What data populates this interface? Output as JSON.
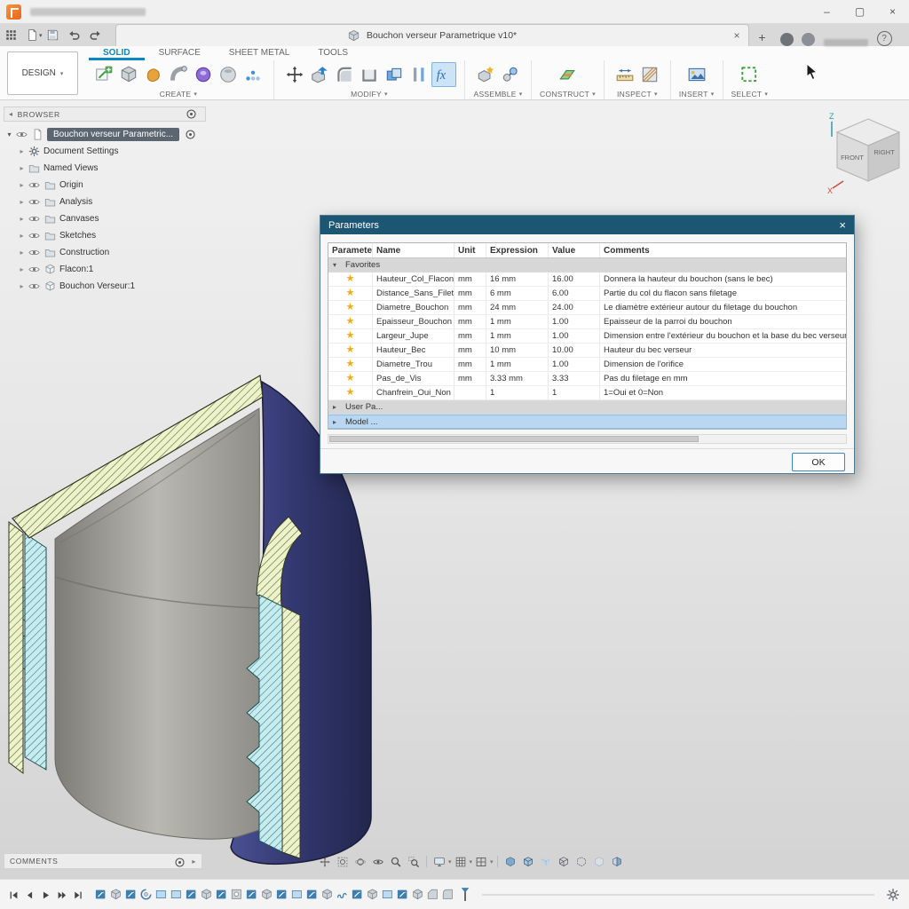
{
  "titlebar": {
    "minimize": "–",
    "maximize": "▢",
    "close": "×"
  },
  "quick_access": {
    "tab_title": "Bouchon verseur Parametrique v10*",
    "tab_close": "×",
    "new_tab": "+",
    "help": "?"
  },
  "ribbon": {
    "design_label": "DESIGN",
    "tabs": [
      "SOLID",
      "SURFACE",
      "SHEET METAL",
      "TOOLS"
    ],
    "active_tab": "SOLID",
    "groups": [
      {
        "label": "CREATE",
        "icons": [
          "create-sketch",
          "primitive-box",
          "form",
          "pipe",
          "torus",
          "sphere",
          "pattern"
        ]
      },
      {
        "label": "MODIFY",
        "icons": [
          "move",
          "press-pull",
          "fillet",
          "shell",
          "combine",
          "align",
          "fx"
        ],
        "active_icon": "fx"
      },
      {
        "label": "ASSEMBLE",
        "icons": [
          "new-component",
          "joint"
        ]
      },
      {
        "label": "CONSTRUCT",
        "icons": [
          "construct-plane"
        ]
      },
      {
        "label": "INSPECT",
        "icons": [
          "measure",
          "section-analysis"
        ]
      },
      {
        "label": "INSERT",
        "icons": [
          "insert-image"
        ]
      },
      {
        "label": "SELECT",
        "icons": [
          "select"
        ]
      }
    ]
  },
  "browser": {
    "header": "BROWSER",
    "root": "Bouchon verseur Parametric...",
    "items": [
      {
        "label": "Document Settings",
        "icon": "gear",
        "eye": false
      },
      {
        "label": "Named Views",
        "icon": "folder",
        "eye": false
      },
      {
        "label": "Origin",
        "icon": "folder",
        "eye": true
      },
      {
        "label": "Analysis",
        "icon": "folder",
        "eye": true
      },
      {
        "label": "Canvases",
        "icon": "folder",
        "eye": true
      },
      {
        "label": "Sketches",
        "icon": "folder",
        "eye": true
      },
      {
        "label": "Construction",
        "icon": "folder",
        "eye": true
      },
      {
        "label": "Flacon:1",
        "icon": "component",
        "eye": true
      },
      {
        "label": "Bouchon Verseur:1",
        "icon": "component",
        "eye": true
      }
    ]
  },
  "viewcube": {
    "front": "FRONT",
    "right": "RIGHT",
    "z_label": "Z",
    "x_label": "X"
  },
  "parameters_dialog": {
    "title": "Parameters",
    "close": "×",
    "columns": [
      "Parameter",
      "Name",
      "Unit",
      "Expression",
      "Value",
      "Comments"
    ],
    "favorites_label": "Favorites",
    "rows": [
      {
        "name": "Hauteur_Col_Flacon",
        "unit": "mm",
        "expression": "16 mm",
        "value": "16.00",
        "comment": "Donnera la hauteur du bouchon (sans le bec)"
      },
      {
        "name": "Distance_Sans_Filet...",
        "unit": "mm",
        "expression": "6 mm",
        "value": "6.00",
        "comment": "Partie du col du flacon sans filetage"
      },
      {
        "name": "Diametre_Bouchon",
        "unit": "mm",
        "expression": "24 mm",
        "value": "24.00",
        "comment": "Le diamètre extérieur autour du filetage du bouchon"
      },
      {
        "name": "Epaisseur_Bouchon",
        "unit": "mm",
        "expression": "1 mm",
        "value": "1.00",
        "comment": "Epaisseur de la parroi du bouchon"
      },
      {
        "name": "Largeur_Jupe",
        "unit": "mm",
        "expression": "1 mm",
        "value": "1.00",
        "comment": "Dimension entre l'extérieur du bouchon et la base du bec verseur"
      },
      {
        "name": "Hauteur_Bec",
        "unit": "mm",
        "expression": "10 mm",
        "value": "10.00",
        "comment": "Hauteur du bec verseur"
      },
      {
        "name": "Diametre_Trou",
        "unit": "mm",
        "expression": "1 mm",
        "value": "1.00",
        "comment": "Dimension de l'orifice"
      },
      {
        "name": "Pas_de_Vis",
        "unit": "mm",
        "expression": "3.33 mm",
        "value": "3.33",
        "comment": "Pas du filetage en mm"
      },
      {
        "name": "Chanfrein_Oui_Non",
        "unit": "",
        "expression": "1",
        "value": "1",
        "comment": "1=Oui  et  0=Non"
      }
    ],
    "group_rows": [
      {
        "label": "User Pa...",
        "selected": false
      },
      {
        "label": "Model ...",
        "selected": true
      }
    ],
    "ok_label": "OK"
  },
  "comments_panel": {
    "label": "COMMENTS"
  },
  "nav_bar": {
    "main_icons": [
      "pan",
      "fit-view",
      "orbit",
      "look-at",
      "zoom",
      "zoom-window"
    ],
    "dropdown_icons": [
      "display-settings",
      "grid-settings",
      "viewports"
    ],
    "view_style_icons": [
      "vs-shaded",
      "vs-shaded-edges",
      "vs-shaded-hidden",
      "vs-wireframe",
      "vs-wire-hidden",
      "vs-ghost",
      "vs-halves"
    ]
  },
  "timeline": {
    "playback_icons": [
      "go-to-start",
      "step-back",
      "play",
      "step-forward",
      "go-to-end"
    ],
    "features": [
      "sketch",
      "extrude",
      "sketch",
      "revolve",
      "rect-pattern",
      "rect-pattern",
      "sketch",
      "extrude",
      "sketch",
      "hole",
      "sketch",
      "extrude",
      "sketch",
      "rect-pattern",
      "sketch",
      "extrude",
      "coil",
      "sketch",
      "extrude",
      "rect-pattern",
      "sketch",
      "extrude",
      "chamfer",
      "fillet"
    ]
  }
}
